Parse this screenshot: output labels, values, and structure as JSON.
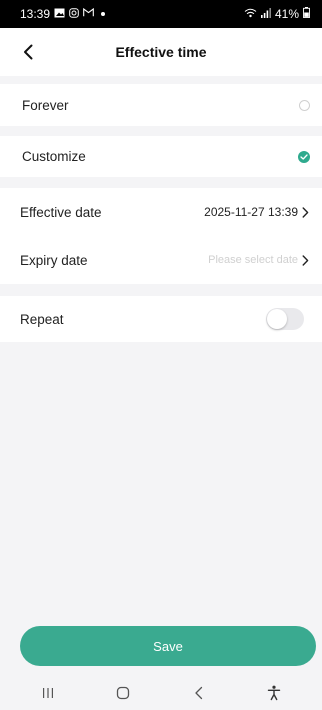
{
  "status_bar": {
    "time": "13:39",
    "battery": "41%"
  },
  "header": {
    "title": "Effective time",
    "back_icon": "chevron-left-icon"
  },
  "options": {
    "forever_label": "Forever",
    "forever_selected": false,
    "customize_label": "Customize",
    "customize_selected": true
  },
  "dates": {
    "effective_label": "Effective date",
    "effective_value": "2025-11-27 13:39",
    "expiry_label": "Expiry date",
    "expiry_placeholder": "Please select date"
  },
  "repeat": {
    "label": "Repeat",
    "enabled": false
  },
  "save_label": "Save",
  "colors": {
    "accent": "#3aaa90",
    "check": "#2faa8e",
    "background": "#f4f4f6"
  }
}
